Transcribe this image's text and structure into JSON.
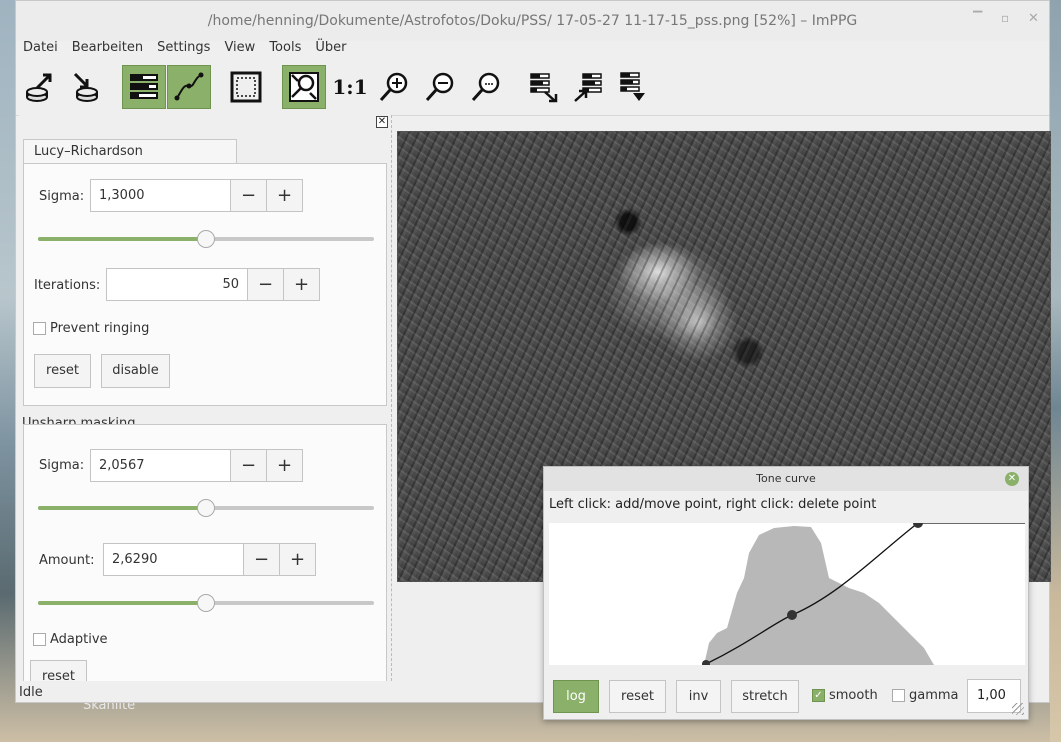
{
  "window": {
    "title": "/home/henning/Dokumente/Astrofotos/Doku/PSS/ 17-05-27 11-17-15_pss.png [52%] – ImPPG"
  },
  "desktop": {
    "label": "Skanlite"
  },
  "menu": [
    "Datei",
    "Bearbeiten",
    "Settings",
    "View",
    "Tools",
    "Über"
  ],
  "toolbar": {
    "zoom_1to1": "1:1",
    "icons": [
      "open-icon",
      "save-icon",
      "toggle-panel-icon",
      "tone-curve-icon",
      "select-all-icon",
      "fit-window-icon",
      "zoom-in-icon",
      "zoom-out-icon",
      "zoom-custom-icon",
      "batch-settings-icon",
      "batch-process-icon",
      "align-icon"
    ]
  },
  "panel": {
    "tab": "Lucy–Richardson deconvolution",
    "lr": {
      "sigma_label": "Sigma:",
      "sigma_value": "1,3000",
      "sigma_slider": 0.5,
      "iterations_label": "Iterations:",
      "iterations_value": "50",
      "prevent_ringing": "Prevent ringing",
      "reset": "reset",
      "disable": "disable"
    },
    "um": {
      "title": "Unsharp masking",
      "sigma_label": "Sigma:",
      "sigma_value": "2,0567",
      "sigma_slider": 0.5,
      "amount_label": "Amount:",
      "amount_value": "2,6290",
      "amount_slider": 0.5,
      "adaptive": "Adaptive",
      "reset": "reset"
    },
    "minus": "−",
    "plus": "+"
  },
  "status": "Idle",
  "tone_curve": {
    "title": "Tone curve",
    "help": "Left click: add/move point, right click: delete point",
    "buttons": {
      "log": "log",
      "reset": "reset",
      "inv": "inv",
      "stretch": "stretch"
    },
    "smooth": "smooth",
    "gamma": "gamma",
    "gamma_value": "1,00",
    "accent": "#8bb06a"
  }
}
